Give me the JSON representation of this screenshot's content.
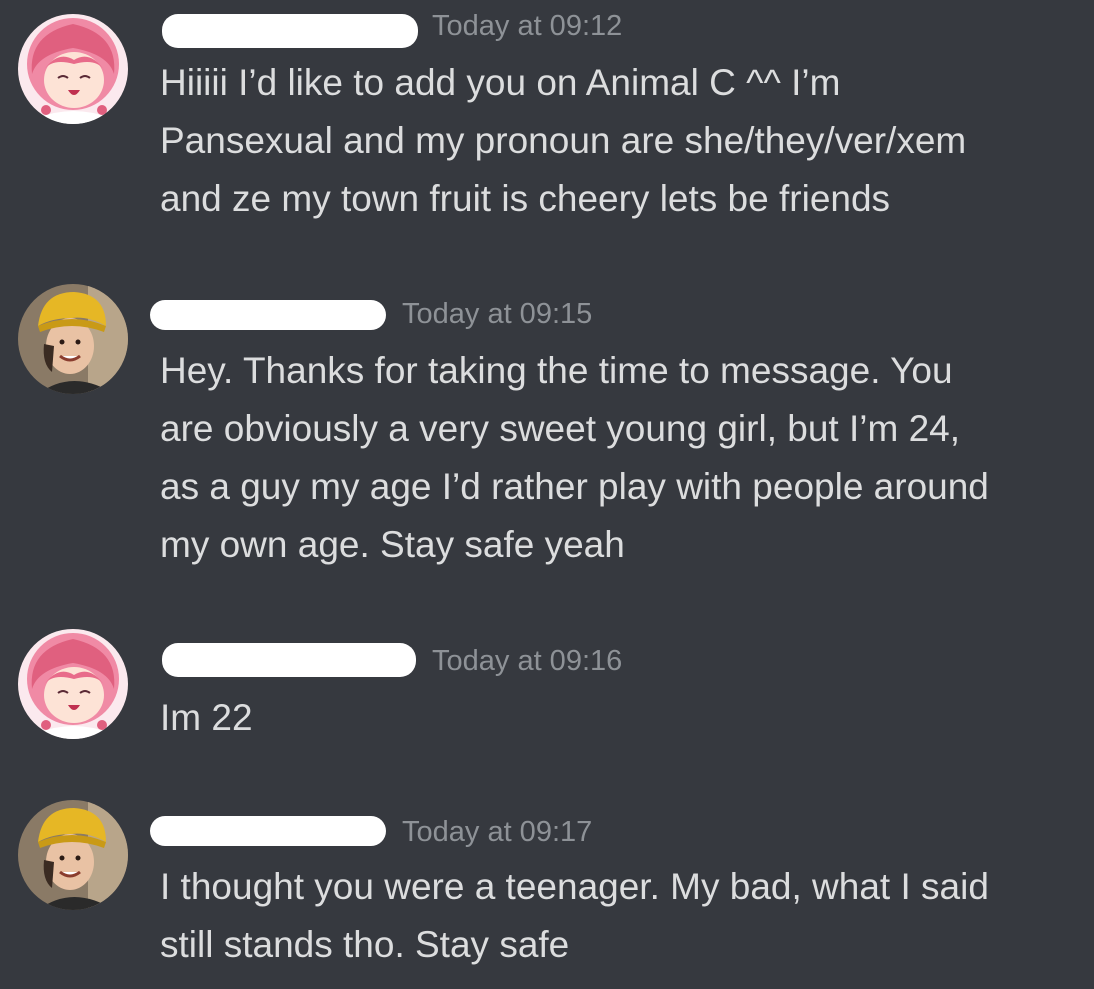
{
  "messages": [
    {
      "author_avatar": "anime-girl-pink-hair",
      "timestamp": "Today at 09:12",
      "lines": [
        "Hiiiii I’d like to add you on Animal C ^^ I’m",
        "Pansexual and my pronoun are she/they/ver/xem",
        "and ze  my town fruit is cheery lets be friends"
      ]
    },
    {
      "author_avatar": "man-yellow-beanie",
      "timestamp": "Today at 09:15",
      "lines": [
        "Hey. Thanks for taking the time to message. You",
        "are obviously a very sweet young girl, but I’m 24,",
        "as a guy my age I’d rather play with people around",
        "my own age. Stay safe yeah"
      ]
    },
    {
      "author_avatar": "anime-girl-pink-hair",
      "timestamp": "Today at 09:16",
      "lines": [
        "Im 22"
      ]
    },
    {
      "author_avatar": "man-yellow-beanie",
      "timestamp": "Today at 09:17",
      "lines": [
        "I thought you were a teenager. My bad, what I said",
        "still stands tho. Stay safe"
      ]
    }
  ],
  "colors": {
    "background": "#36393f",
    "message_text": "#dcddde",
    "timestamp_text": "#8e9297",
    "redaction": "#ffffff"
  }
}
